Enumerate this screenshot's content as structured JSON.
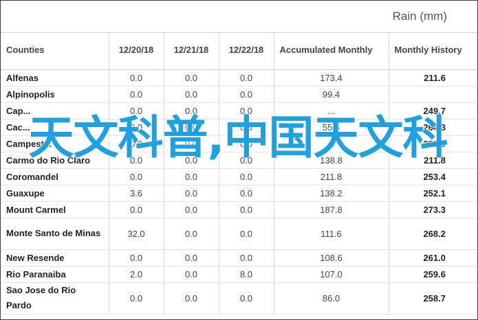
{
  "title": "Rain (mm)",
  "columns": [
    "Counties",
    "12/20/18",
    "12/21/18",
    "12/22/18",
    "Accumulated Monthly",
    "Monthly History"
  ],
  "rows": [
    {
      "county": "Alfenas",
      "d1": "0.0",
      "d2": "0.0",
      "d3": "0.0",
      "acc": "173.4",
      "hist": "211.6"
    },
    {
      "county": "Alpinopolis",
      "d1": "0.0",
      "d2": "0.0",
      "d3": "0.0",
      "acc": "99.4",
      "hist": ""
    },
    {
      "county": "Cap...",
      "d1": "0.0",
      "d2": "0.0",
      "d3": "0.0",
      "acc": "...",
      "hist": "249.7"
    },
    {
      "county": "Cac...",
      "d1": "0.0",
      "d2": "0.0",
      "d3": "0.0",
      "acc": "55.5",
      "hist": "264.3"
    },
    {
      "county": "Campest...",
      "d1": "0.0",
      "d2": "0.0",
      "d3": "0.0",
      "acc": "...",
      "hist": "252.9"
    },
    {
      "county": "Carmo do Rio Claro",
      "d1": "0.0",
      "d2": "0.0",
      "d3": "0.0",
      "acc": "138.8",
      "hist": "211.8"
    },
    {
      "county": "Coromandel",
      "d1": "0.0",
      "d2": "0.0",
      "d3": "0.0",
      "acc": "211.8",
      "hist": "253.4"
    },
    {
      "county": "Guaxupe",
      "d1": "3.6",
      "d2": "0.0",
      "d3": "0.0",
      "acc": "138.2",
      "hist": "252.1"
    },
    {
      "county": "Mount Carmel",
      "d1": "0.0",
      "d2": "0.0",
      "d3": "0.0",
      "acc": "187.8",
      "hist": "273.3"
    },
    {
      "county": "Monte Santo de Minas",
      "d1": "32.0",
      "d2": "0.0",
      "d3": "0.0",
      "acc": "111.6",
      "hist": "268.2",
      "tall": true
    },
    {
      "county": "New Resende",
      "d1": "0.0",
      "d2": "0.0",
      "d3": "0.0",
      "acc": "108.6",
      "hist": "261.0"
    },
    {
      "county": "Rio Paranaiba",
      "d1": "2.0",
      "d2": "0.0",
      "d3": "8.0",
      "acc": "107.0",
      "hist": "259.6"
    },
    {
      "county": "Sao Jose do Rio Pardo",
      "d1": "0.0",
      "d2": "0.0",
      "d3": "0.0",
      "acc": "86.0",
      "hist": "258.7",
      "tall": true
    }
  ],
  "watermark": "天文科普,中国天文科"
}
